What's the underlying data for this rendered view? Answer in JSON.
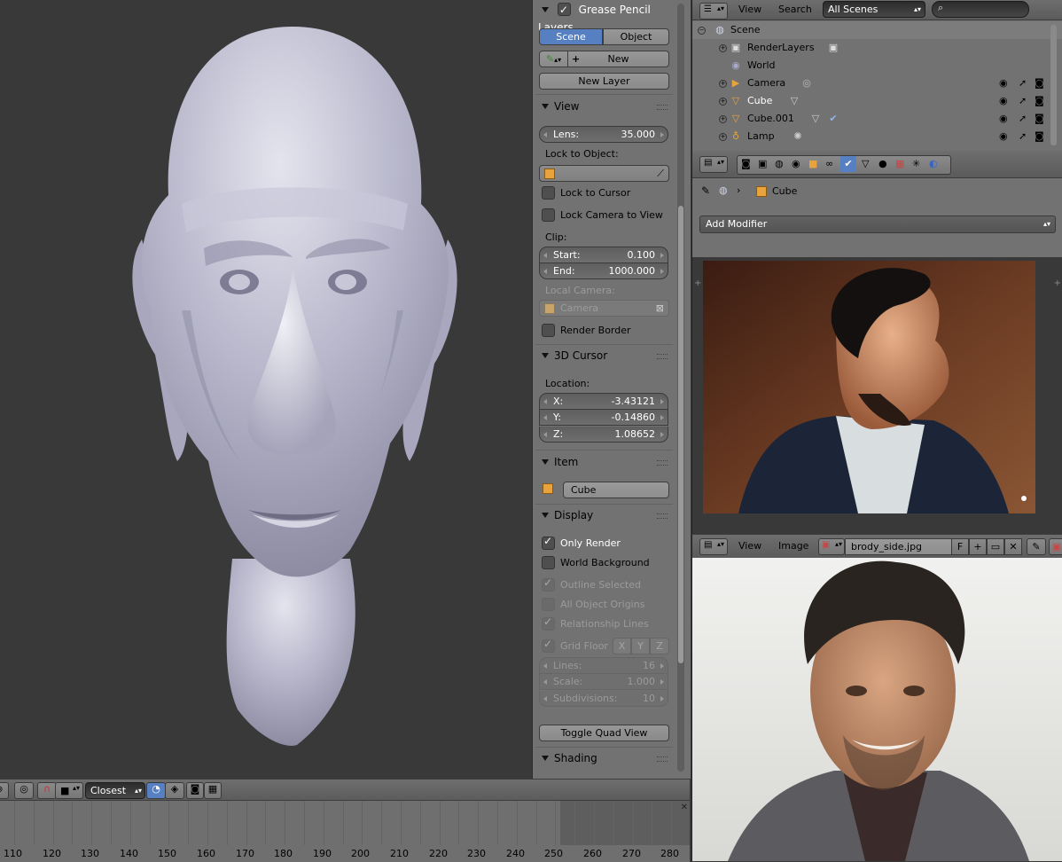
{
  "npanel": {
    "grease_pencil": {
      "title": "Grease Pencil Layers",
      "scene_tab": "Scene",
      "object_tab": "Object",
      "new_label": "New",
      "new_layer_label": "New Layer"
    },
    "view": {
      "title": "View",
      "lens_label": "Lens:",
      "lens_value": "35.000",
      "lock_to_object_label": "Lock to Object:",
      "lock_to_cursor": "Lock to Cursor",
      "lock_camera_to_view": "Lock Camera to View",
      "clip_label": "Clip:",
      "clip_start_label": "Start:",
      "clip_start_value": "0.100",
      "clip_end_label": "End:",
      "clip_end_value": "1000.000",
      "local_camera_label": "Local Camera:",
      "local_camera_value": "Camera",
      "render_border": "Render Border"
    },
    "cursor": {
      "title": "3D Cursor",
      "location_label": "Location:",
      "x_label": "X:",
      "x_value": "-3.43121",
      "y_label": "Y:",
      "y_value": "-0.14860",
      "z_label": "Z:",
      "z_value": "1.08652"
    },
    "item": {
      "title": "Item",
      "name": "Cube"
    },
    "display": {
      "title": "Display",
      "only_render": "Only Render",
      "world_background": "World Background",
      "outline_selected": "Outline Selected",
      "all_object_origins": "All Object Origins",
      "relationship_lines": "Relationship Lines",
      "grid_floor": "Grid Floor",
      "axis_x": "X",
      "axis_y": "Y",
      "axis_z": "Z",
      "lines_label": "Lines:",
      "lines_value": "16",
      "scale_label": "Scale:",
      "scale_value": "1.000",
      "subdiv_label": "Subdivisions:",
      "subdiv_value": "10",
      "toggle_quad": "Toggle Quad View"
    },
    "shading": {
      "title": "Shading"
    }
  },
  "outliner": {
    "menu_view": "View",
    "menu_search": "Search",
    "scenes_dropdown": "All Scenes",
    "rows": [
      {
        "name": "Scene"
      },
      {
        "name": "RenderLayers"
      },
      {
        "name": "World"
      },
      {
        "name": "Camera"
      },
      {
        "name": "Cube"
      },
      {
        "name": "Cube.001"
      },
      {
        "name": "Lamp"
      }
    ]
  },
  "properties": {
    "object_name": "Cube",
    "add_modifier": "Add Modifier"
  },
  "image_editor": {
    "menu_view": "View",
    "menu_image": "Image",
    "image_name": "brody_side.jpg",
    "fake_user": "F"
  },
  "viewport_header": {
    "snap_mode": "Closest"
  },
  "timeline": {
    "ticks": [
      "110",
      "120",
      "130",
      "140",
      "150",
      "160",
      "170",
      "180",
      "190",
      "200",
      "210",
      "220",
      "230",
      "240",
      "250",
      "260",
      "270",
      "280"
    ]
  },
  "colors": {
    "selected_blue": "#5680c2",
    "panel_bg": "#727272",
    "viewport_bg": "#393939",
    "cube_icon": "#e8a33d"
  }
}
